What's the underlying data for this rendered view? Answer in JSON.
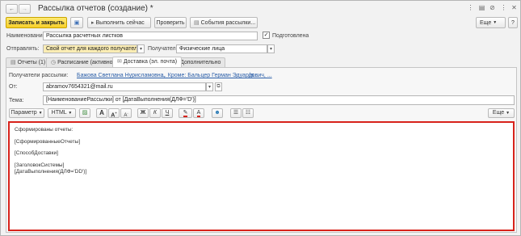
{
  "window": {
    "title": "Рассылка отчетов (создание) *"
  },
  "toolbar": {
    "save_close": "Записать и закрыть",
    "run_now": "Выполнить сейчас",
    "check": "Проверить",
    "events": "События рассылки...",
    "more": "Еще"
  },
  "form": {
    "name_label": "Наименование:",
    "name_value": "Рассылка расчетных листков",
    "prepared_label": "Подготовлена",
    "send_label": "Отправлять:",
    "send_value": "Свой отчет для каждого получателя",
    "recipients_label": "Получатели:",
    "recipients_value": "Физические лица"
  },
  "tabs": [
    {
      "label": "Отчеты (1)"
    },
    {
      "label": "Расписание (активно)"
    },
    {
      "label": "Доставка (эл. почта)"
    },
    {
      "label": "Дополнительно"
    }
  ],
  "delivery": {
    "mail_recipients_label": "Получатели рассылки:",
    "mail_recipients_link1": "Бажова Светлана Нурисламовна,",
    "mail_recipients_link2": "... Кроме: Бальцер Герман Эдуардович, ...",
    "mail_recipients_link3": "(в...",
    "from_label": "От:",
    "from_value": "abramov7654321@mail.ru",
    "subject_label": "Тема:",
    "subject_value": "[НаименованиеРассылки] от [ДатаВыполнения(ДЛФ='D')]"
  },
  "editor": {
    "param_btn": "Параметр",
    "html_btn": "HTML",
    "bold": "Ж",
    "italic": "К",
    "underline": "Ч",
    "font_a": "A",
    "font_a_up": "A",
    "font_a_down": "A",
    "more": "Еще",
    "lines": [
      "Сформированы отчеты:",
      "[СформированныеОтчеты]",
      "[СпособДоставки]",
      "[ЗаголовокСистемы]",
      "[ДатаВыполнения(ДЛФ='DD')]"
    ]
  },
  "colors": {
    "primary_button": "#f7cf2a",
    "editor_border": "#d8231c",
    "link": "#2a5ea8",
    "yellow_field": "#fbedb4"
  }
}
